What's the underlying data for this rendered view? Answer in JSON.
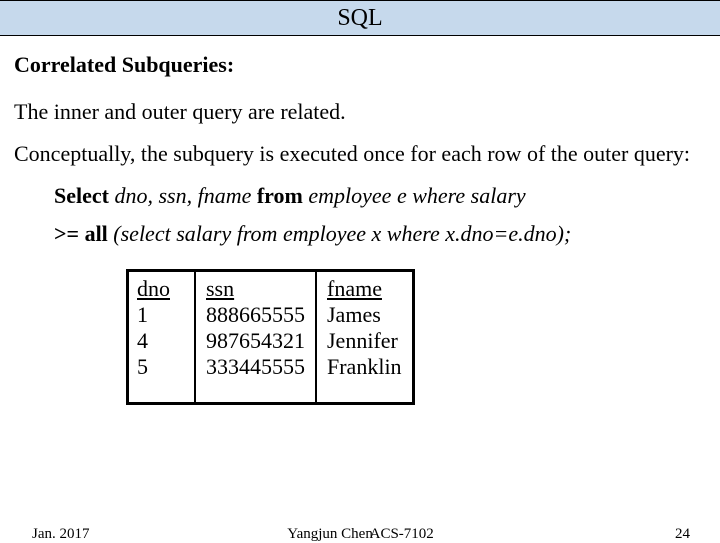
{
  "title": "SQL",
  "heading": "Correlated Subqueries:",
  "p1": "The inner and outer query are related.",
  "p2": "Conceptually, the subquery is executed once for each row of the outer query:",
  "q1_pre": "Select ",
  "q1_mid": "dno, ssn, fname",
  "q1_from": " from ",
  "q1_tbl": "employee e where salary",
  "q2_op": ">= all ",
  "q2_rest": "(select salary from employee x where x.dno=e.dno);",
  "table": {
    "headers": [
      "dno",
      "ssn",
      "fname"
    ],
    "rows": [
      [
        "1",
        "888665555",
        "James"
      ],
      [
        "4",
        "987654321",
        "Jennifer"
      ],
      [
        "5",
        "333445555",
        "Franklin"
      ]
    ]
  },
  "footer": {
    "date": "Jan. 2017",
    "author": "Yangjun Chen",
    "course": "ACS-7102",
    "page": "24"
  }
}
